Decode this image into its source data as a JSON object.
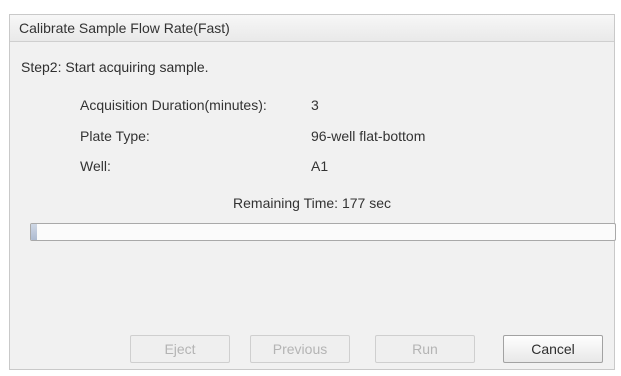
{
  "dialog": {
    "title": "Calibrate Sample Flow Rate(Fast)",
    "step": "Step2: Start acquiring sample.",
    "fields": [
      {
        "label": "Acquisition Duration(minutes):",
        "value": "3"
      },
      {
        "label": "Plate Type:",
        "value": "96-well flat-bottom"
      },
      {
        "label": "Well:",
        "value": "A1"
      }
    ],
    "remaining": "Remaining Time: 177 sec",
    "progress_fraction": 0.01
  },
  "buttons": {
    "eject": "Eject",
    "previous": "Previous",
    "run": "Run",
    "cancel": "Cancel"
  }
}
